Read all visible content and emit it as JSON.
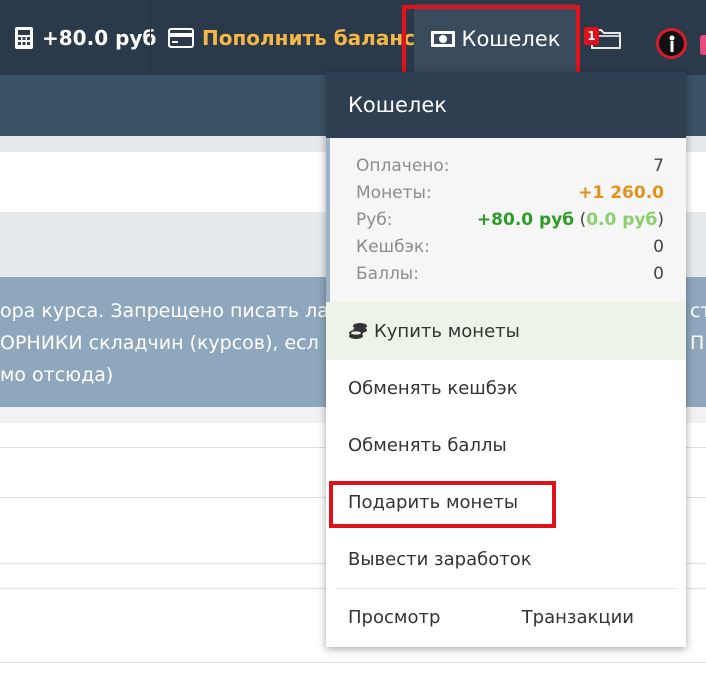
{
  "topnav": {
    "balance": "+80.0 руб",
    "topup_label": "Пополнить баланс",
    "wallet_label": "Кошелек",
    "notification_count": "1"
  },
  "notice": {
    "lines": [
      "ора курса. Запрещено писать ла",
      "ОРНИКИ складчин (курсов), есл",
      "мо отсюда)"
    ],
    "right_fragments": [
      "ст",
      "ПР"
    ]
  },
  "wallet": {
    "title": "Кошелек",
    "stats": {
      "paid_label": "Оплачено:",
      "paid_value": "7",
      "coins_label": "Монеты:",
      "coins_value": "+1 260.0",
      "rub_label": "Руб:",
      "rub_value": "+80.0 руб",
      "rub_sub_value": "0.0 руб",
      "cashback_label": "Кешбэк:",
      "cashback_value": "0",
      "points_label": "Баллы:",
      "points_value": "0"
    },
    "menu": {
      "buy_coins": "Купить монеты",
      "exchange_cashback": "Обменять кешбэк",
      "exchange_points": "Обменять баллы",
      "gift_coins": "Подарить монеты",
      "withdraw_earnings": "Вывести заработок",
      "view": "Просмотр",
      "transactions": "Транзакции"
    }
  },
  "colors": {
    "nav_bg": "#2b3a4a",
    "accent_orange": "#f5b847",
    "highlight_red": "#e0111b",
    "coins_orange": "#e2901c",
    "rub_green": "#2e9a28"
  }
}
